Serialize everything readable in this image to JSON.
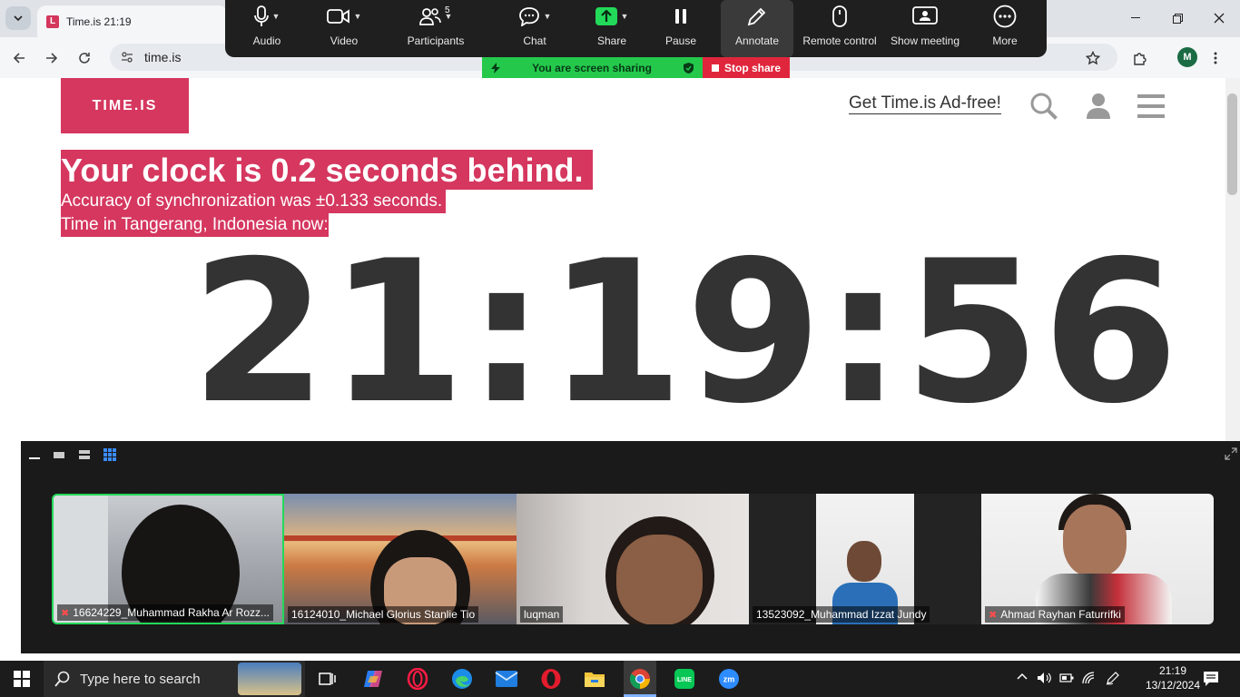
{
  "browser": {
    "tab_title": "Time.is 21:19",
    "url": "time.is",
    "profile_initial": "M"
  },
  "zoom_toolbar": {
    "items": [
      {
        "label": "Audio",
        "icon": "microphone-icon"
      },
      {
        "label": "Video",
        "icon": "video-camera-icon"
      },
      {
        "label": "Participants",
        "icon": "participants-icon",
        "count": "5"
      },
      {
        "label": "Chat",
        "icon": "chat-icon"
      },
      {
        "label": "Share",
        "icon": "share-screen-icon"
      },
      {
        "label": "Pause",
        "icon": "pause-icon"
      },
      {
        "label": "Annotate",
        "icon": "pencil-icon"
      },
      {
        "label": "Remote control",
        "icon": "mouse-icon"
      },
      {
        "label": "Show meeting",
        "icon": "show-meeting-icon"
      },
      {
        "label": "More",
        "icon": "more-dots-icon"
      }
    ],
    "sharing_status": "You are screen sharing",
    "stop_share": "Stop share"
  },
  "page": {
    "logo": "TIME.IS",
    "adfree_link": "Get Time.is Ad-free!",
    "headline": "Your clock is 0.2 seconds behind.",
    "accuracy": "Accuracy of synchronization was ±0.133 seconds.",
    "location_line": "Time in Tangerang, Indonesia now:",
    "clock": "21:19:56"
  },
  "gallery": {
    "participants": [
      {
        "name": "16624229_Muhammad Rakha Ar Rozz...",
        "muted": true,
        "active": true
      },
      {
        "name": "16124010_Michael Glorius Stanlie Tio",
        "muted": false,
        "active": false
      },
      {
        "name": "luqman",
        "muted": false,
        "active": false
      },
      {
        "name": "13523092_Muhammad Izzat Jundy",
        "muted": false,
        "active": false
      },
      {
        "name": "Ahmad Rayhan Faturrifki",
        "muted": true,
        "active": false
      }
    ]
  },
  "taskbar": {
    "search_placeholder": "Type here to search",
    "time": "21:19",
    "date": "13/12/2024",
    "apps": [
      "task-view-icon",
      "copilot-icon",
      "opera-gx-icon",
      "edge-icon",
      "mail-icon",
      "opera-icon",
      "file-explorer-icon",
      "chrome-icon",
      "line-icon",
      "zoom-icon"
    ]
  },
  "colors": {
    "brand": "#d5375f",
    "zoom_bar": "#1f1f1f",
    "share_green": "#23d959",
    "stop_red": "#e0263c"
  }
}
